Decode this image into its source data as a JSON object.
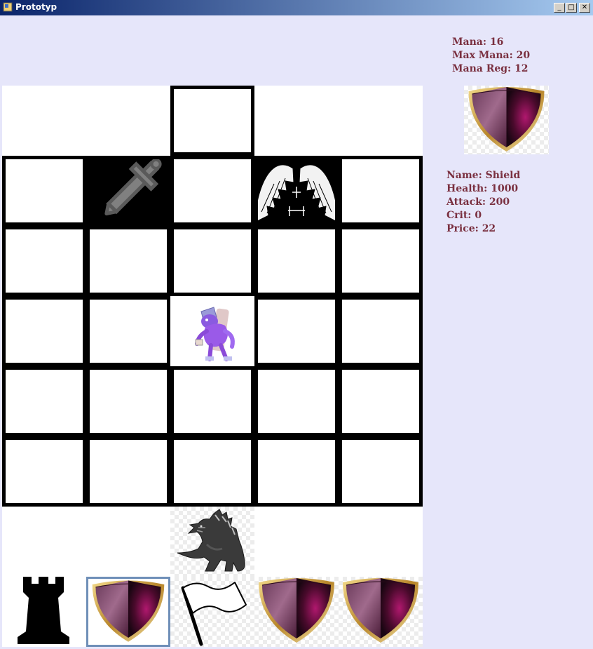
{
  "window": {
    "title": "Prototyp",
    "min_symbol": "_",
    "max_symbol": "□",
    "close_symbol": "✕"
  },
  "player": {
    "mana_label": "Mana: 16",
    "max_mana_label": "Max Mana: 20",
    "mana_reg_label": "Mana Reg: 12"
  },
  "selected_card": {
    "icon": "shield-icon",
    "name_label": "Name: Shield",
    "health_label": "Health: 1000",
    "attack_label": "Attack: 200",
    "crit_label": "Crit: 0",
    "price_label": "Price: 22"
  },
  "board": {
    "top_slot": "empty",
    "pieces": [
      {
        "icon": "sword-icon",
        "cell": "row1-col1"
      },
      {
        "icon": "angel-wings-icon",
        "cell": "row1-col3"
      },
      {
        "icon": "purple-zombie-sprite",
        "cell": "row3-col2"
      },
      {
        "icon": "godzilla-monster-sprite",
        "cell": "hero-slot"
      }
    ]
  },
  "hand": [
    {
      "icon": "rook-tower-icon",
      "selected": false
    },
    {
      "icon": "shield-icon",
      "selected": true
    },
    {
      "icon": "white-flag-icon",
      "selected": false
    },
    {
      "icon": "shield-icon",
      "selected": false
    },
    {
      "icon": "shield-icon",
      "selected": false
    }
  ],
  "colors": {
    "background": "#e6e6fa",
    "text": "#7a3040",
    "selection": "#6f8fb8"
  }
}
